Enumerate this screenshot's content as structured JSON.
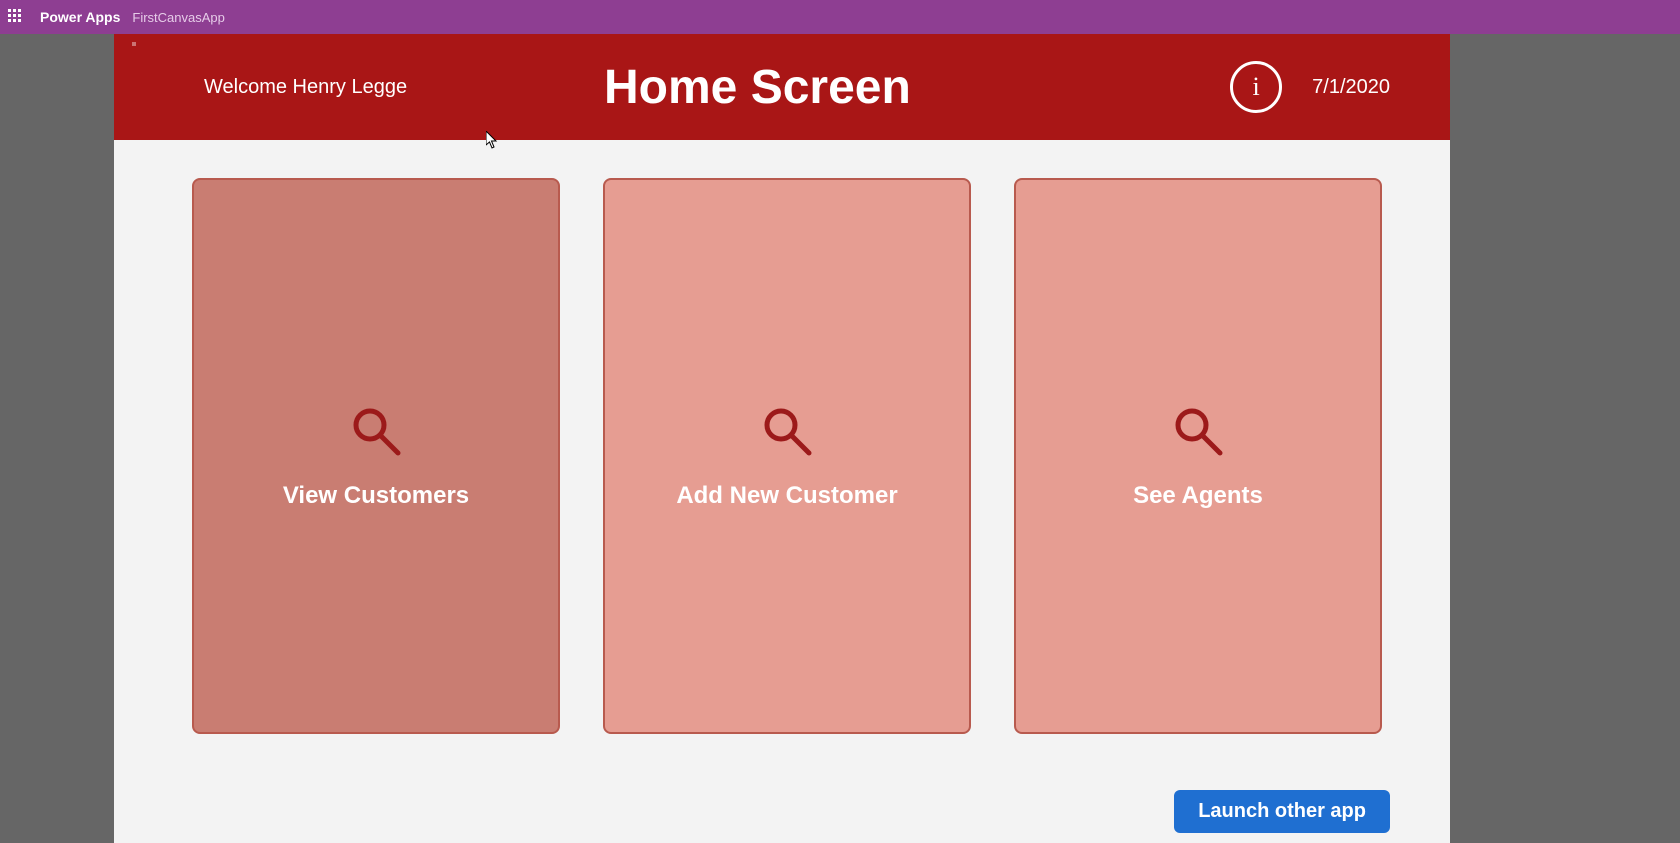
{
  "topbar": {
    "brand": "Power Apps",
    "app_name": "FirstCanvasApp"
  },
  "header": {
    "welcome": "Welcome Henry Legge",
    "title": "Home Screen",
    "info_glyph": "i",
    "date": "7/1/2020"
  },
  "cards": [
    {
      "label": "View Customers"
    },
    {
      "label": "Add New Customer"
    },
    {
      "label": "See Agents"
    }
  ],
  "launch_button": "Launch other app"
}
